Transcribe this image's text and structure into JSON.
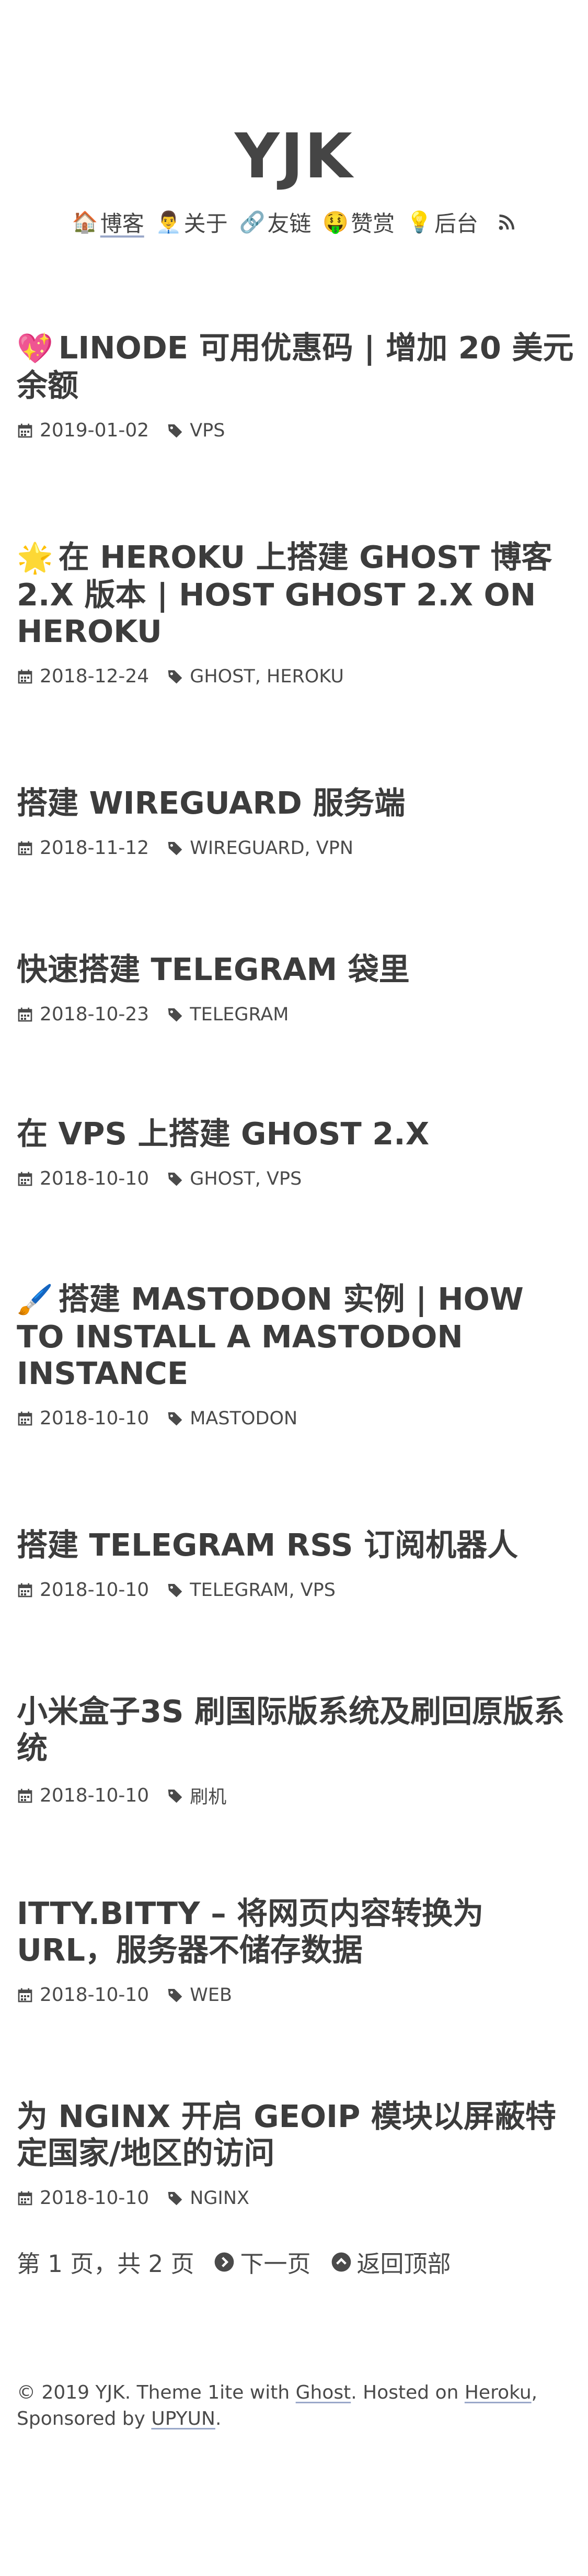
{
  "site": {
    "title": "YJK"
  },
  "nav": {
    "items": [
      {
        "emoji": "🏠",
        "label": "博客",
        "icon": "house-icon"
      },
      {
        "emoji": "👨‍💼",
        "label": "关于",
        "icon": "person-icon"
      },
      {
        "emoji": "🔗",
        "label": "友链",
        "icon": "link-icon"
      },
      {
        "emoji": "🤑",
        "label": "赞赏",
        "icon": "money-face-icon"
      },
      {
        "emoji": "💡",
        "label": "后台",
        "icon": "lightbulb-icon"
      }
    ],
    "rss_icon": "rss-icon"
  },
  "posts": [
    {
      "emoji": "💖",
      "title": "LINODE 可用优惠码 | 增加 20 美元余额",
      "date": "2019-01-02",
      "tags": "VPS"
    },
    {
      "emoji": "🌟",
      "title": "在 HEROKU 上搭建 GHOST 博客 2.X 版本 | HOST GHOST 2.X ON HEROKU",
      "date": "2018-12-24",
      "tags": "GHOST, HEROKU"
    },
    {
      "emoji": "",
      "title": "搭建 WIREGUARD 服务端",
      "date": "2018-11-12",
      "tags": "WIREGUARD, VPN"
    },
    {
      "emoji": "",
      "title": "快速搭建 TELEGRAM 袋里",
      "date": "2018-10-23",
      "tags": "TELEGRAM"
    },
    {
      "emoji": "",
      "title": "在 VPS 上搭建 GHOST 2.X",
      "date": "2018-10-10",
      "tags": "GHOST, VPS"
    },
    {
      "emoji": "🖌️",
      "title": "搭建 MASTODON 实例 | HOW TO INSTALL A MASTODON INSTANCE",
      "date": "2018-10-10",
      "tags": "MASTODON"
    },
    {
      "emoji": "",
      "title": "搭建 TELEGRAM RSS 订阅机器人",
      "date": "2018-10-10",
      "tags": "TELEGRAM, VPS"
    },
    {
      "emoji": "",
      "title": "小米盒子3S 刷国际版系统及刷回原版系统",
      "date": "2018-10-10",
      "tags": "刷机"
    },
    {
      "emoji": "",
      "title": "ITTY.BITTY – 将网页内容转换为 URL，服务器不储存数据",
      "date": "2018-10-10",
      "tags": "WEB"
    },
    {
      "emoji": "",
      "title": "为 NGINX 开启 GEOIP 模块以屏蔽特定国家/地区的访问",
      "date": "2018-10-10",
      "tags": "NGINX"
    }
  ],
  "pagination": {
    "status": "第 1 页，共 2 页",
    "next_label": "下一页",
    "top_label": "返回顶部"
  },
  "footer": {
    "text_1": "© 2019 YJK. Theme 1ite with ",
    "link_ghost": "Ghost",
    "text_2": ". Hosted on ",
    "link_heroku": "Heroku",
    "text_3": ", Sponsored by ",
    "link_upyun": "UPYUN",
    "text_4": "."
  },
  "colors": {
    "text": "#3a3a3a",
    "link_underline": "#9aa8c9"
  }
}
